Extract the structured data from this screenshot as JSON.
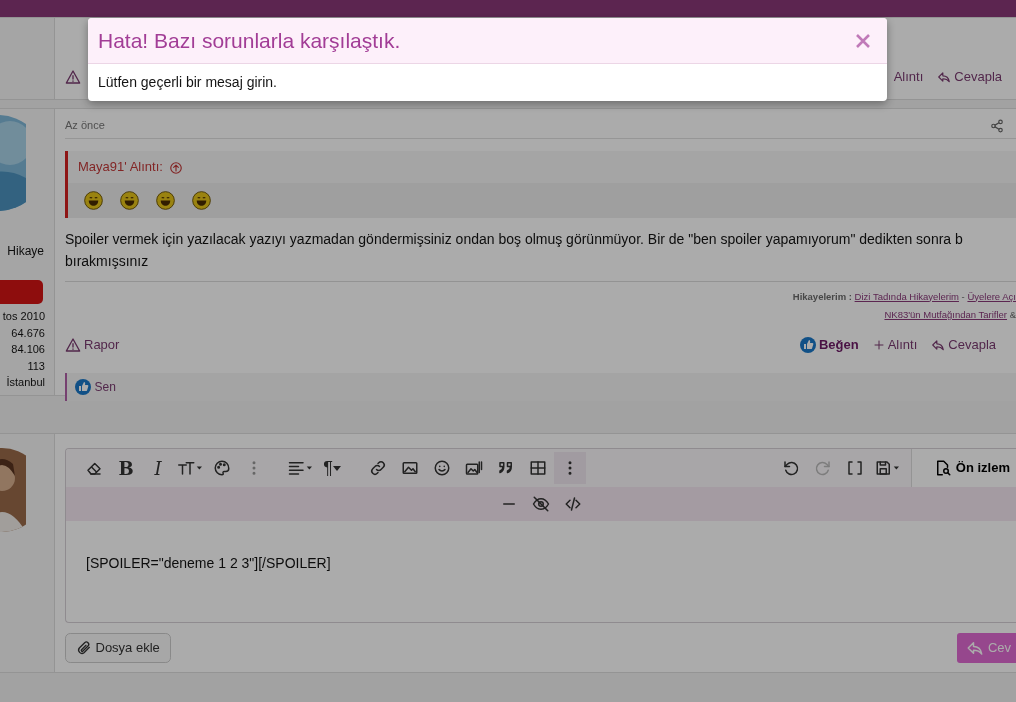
{
  "modal": {
    "title": "Hata! Bazı sorunlarla karşılaştık.",
    "message": "Lütfen geçerli bir mesaj girin."
  },
  "post_top": {
    "quote": "Alıntı",
    "reply": "Cevapla"
  },
  "post": {
    "user_title": "Hikaye",
    "stats": [
      "tos 2010",
      "64.676",
      "84.106",
      "113",
      "İstanbul"
    ],
    "time": "Az önce",
    "quote_author": "Maya91' Alıntı:",
    "lines": [
      "Spoiler vermek için yazılacak yazıyı yazmadan göndermişsiniz ondan boş olmuş görünmüyor. Bir de \"ben spoiler yapamıyorum\" dedikten sonra b",
      "bırakmışsınız"
    ],
    "signature": {
      "label": "Hikayelerim :",
      "link_1": "Dizi Tadında Hikayelerim",
      "separator": "-",
      "link_2": "Üyelere Açı",
      "link_3": "NK83'ün Mutfağından Tarifler",
      "amp": "&"
    },
    "actions": {
      "report": "Rapor",
      "like": "Beğen",
      "quote": "Alıntı",
      "reply": "Cevapla"
    },
    "reactions": "Sen"
  },
  "editor": {
    "bold": "B",
    "italic": "I",
    "paragraph": "¶",
    "redo_disabled": true,
    "preview": "Ön izlem",
    "content": "[SPOILER=\"deneme 1 2 3\"][/SPOILER]",
    "attach": "Dosya ekle",
    "submit": "Cev"
  }
}
